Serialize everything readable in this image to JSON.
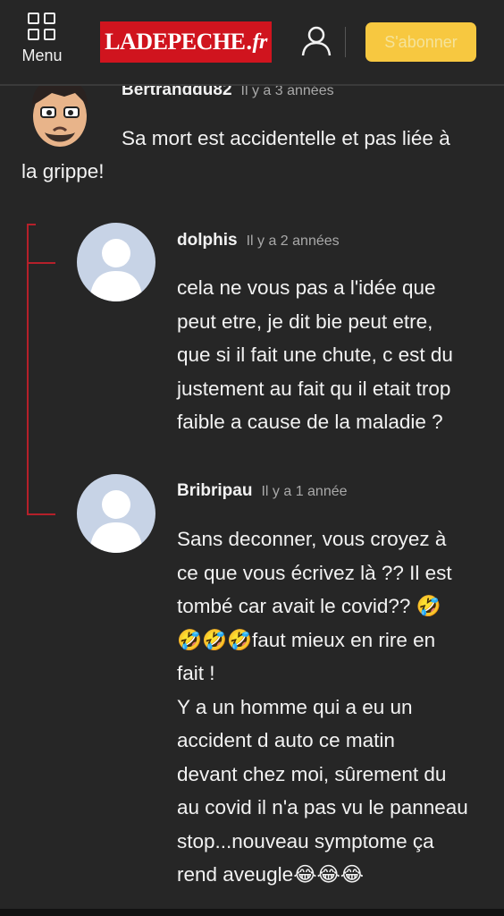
{
  "header": {
    "menu_label": "Menu",
    "logo_main": "LADEPECHE",
    "logo_dot": ".",
    "logo_tld": "fr",
    "subscribe_label": "S'abonner",
    "brand_color": "#d0141e",
    "subscribe_color": "#f7c840"
  },
  "comments": [
    {
      "author": "Bertranddu82",
      "time": "Il y a 3 années",
      "text_line1": "Sa mort est accidentelle et pas liée à",
      "text_line2": "la grippe!"
    },
    {
      "author": "dolphis",
      "time": "Il y a 2 années",
      "lines": [
        "cela ne vous pas a l'idée que",
        "peut etre, je dit bie peut etre,",
        "que si il fait une chute, c est du",
        "justement au fait qu il etait trop",
        "faible a cause de la maladie ?"
      ]
    },
    {
      "author": "Bribripau",
      "time": "Il y a 1 année",
      "lines": [
        "Sans deconner, vous croyez à",
        "ce que vous écrivez là ?? Il est",
        "tombé car avait le covid?? 🤣",
        "🤣🤣🤣faut mieux en rire en",
        "fait !",
        "Y a un homme qui a eu un",
        "accident d auto ce matin",
        "devant chez moi, sûrement du",
        "au covid il n'a pas vu le panneau",
        "stop...nouveau symptome ça",
        "rend aveugle😂😂😂"
      ]
    }
  ]
}
